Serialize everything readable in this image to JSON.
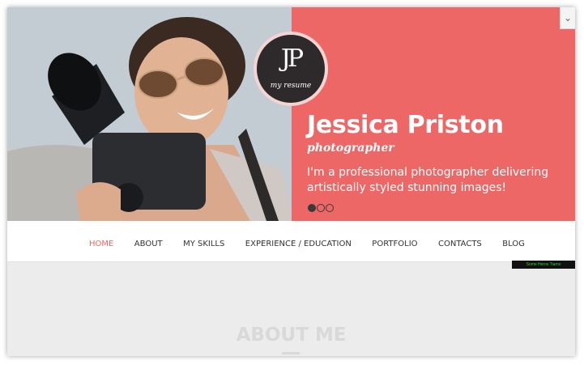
{
  "logo": {
    "monogram": "JP",
    "tagline": "my resume"
  },
  "hero": {
    "name": "Jessica Priston",
    "role": "photographer",
    "description": "I'm a professional photographer delivering artistically styled stunning images!",
    "slides": 3,
    "active_slide": 1
  },
  "nav": {
    "items": [
      {
        "label": "HOME",
        "active": true
      },
      {
        "label": "ABOUT"
      },
      {
        "label": "MY SKILLS"
      },
      {
        "label": "EXPERIENCE / EDUCATION"
      },
      {
        "label": "PORTFOLIO"
      },
      {
        "label": "CONTACTS"
      },
      {
        "label": "BLOG"
      }
    ]
  },
  "footer_tag": "Some Heros  Tiamo",
  "scroll_icon": "chevron-down-icon",
  "about": {
    "title": "ABOUT ME"
  },
  "colors": {
    "accent": "#ee6767",
    "logo_bg": "#2e2a2b",
    "page_bg": "#ececec"
  }
}
